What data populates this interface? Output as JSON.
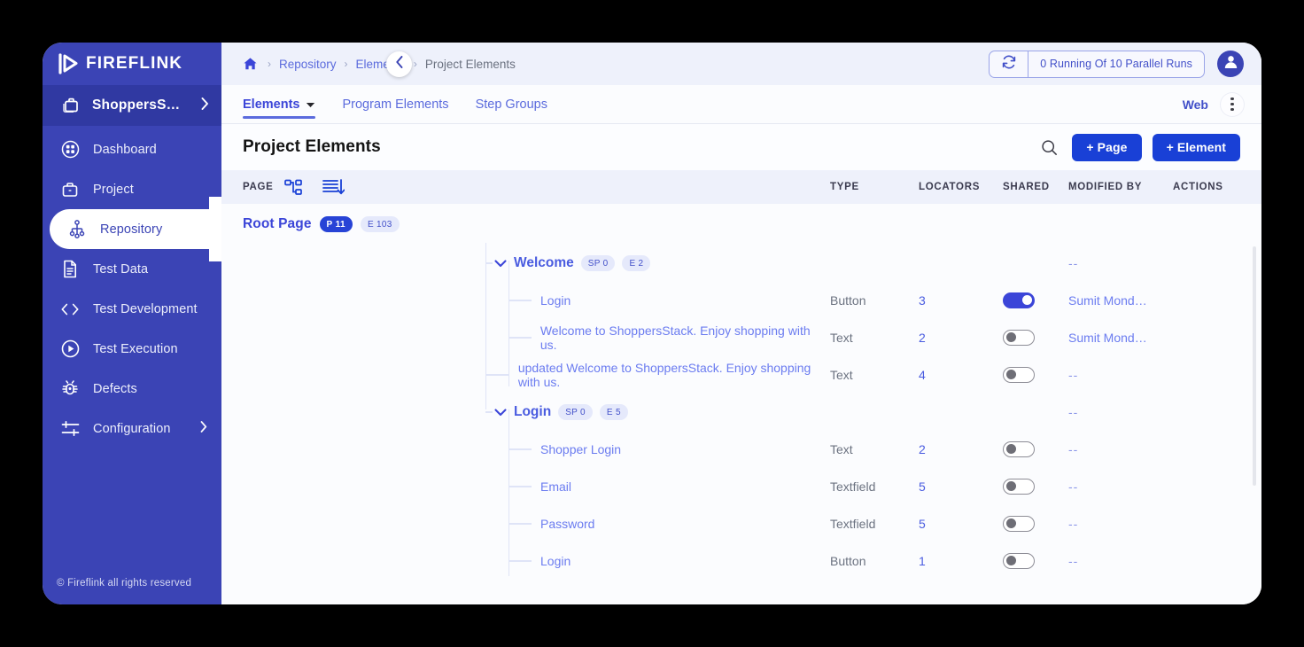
{
  "brand": {
    "name": "FIREFLINK"
  },
  "sidebar": {
    "project": {
      "label": "ShoppersS…",
      "chevron": "›"
    },
    "items": [
      {
        "label": "Dashboard",
        "icon": "dashboard-grid-icon",
        "active": false,
        "chevron": ""
      },
      {
        "label": "Project",
        "icon": "briefcase-icon",
        "active": false,
        "chevron": ""
      },
      {
        "label": "Repository",
        "icon": "repository-node-icon",
        "active": true,
        "chevron": ""
      },
      {
        "label": "Test Data",
        "icon": "document-icon",
        "active": false,
        "chevron": ""
      },
      {
        "label": "Test Development",
        "icon": "code-brackets-icon",
        "active": false,
        "chevron": ""
      },
      {
        "label": "Test Execution",
        "icon": "play-circle-icon",
        "active": false,
        "chevron": ""
      },
      {
        "label": "Defects",
        "icon": "bug-icon",
        "active": false,
        "chevron": ""
      },
      {
        "label": "Configuration",
        "icon": "sliders-icon",
        "active": false,
        "chevron": "›"
      }
    ],
    "footer": "© Fireflink all rights reserved"
  },
  "topbar": {
    "home_icon": "home-icon",
    "breadcrumbs": [
      {
        "label": "Repository",
        "current": false
      },
      {
        "label": "Elements",
        "current": false
      },
      {
        "label": "Project Elements",
        "current": true
      }
    ],
    "separator": "›",
    "refresh_icon": "refresh-icon",
    "runs_label": "0 Running Of 10 Parallel Runs",
    "avatar_icon": "user-avatar-icon",
    "collapse_icon": "chevron-left-icon"
  },
  "tabs": {
    "items": [
      {
        "label": "Elements",
        "active": true,
        "caret": true
      },
      {
        "label": "Program Elements",
        "active": false,
        "caret": false
      },
      {
        "label": "Step Groups",
        "active": false,
        "caret": false
      }
    ],
    "platform": "Web",
    "menu_icon": "kebab-menu-icon"
  },
  "title": {
    "heading": "Project Elements",
    "search_icon": "search-icon",
    "add_page": "+ Page",
    "add_element": "+ Element"
  },
  "table": {
    "headers": {
      "page": "PAGE",
      "hierarchy_icon": "hierarchy-tree-icon",
      "sort_icon": "sort-descending-icon",
      "type": "TYPE",
      "locators": "LOCATORS",
      "shared": "SHARED",
      "modified_by": "MODIFIED BY",
      "actions": "ACTIONS"
    },
    "rows": [
      {
        "kind": "page",
        "level": 0,
        "name": "Root Page",
        "badges": [
          {
            "text": "P 11",
            "style": "dark"
          },
          {
            "text": "E 103",
            "style": "light"
          }
        ],
        "type": "",
        "locators": "",
        "shared": null,
        "modified_by": ""
      },
      {
        "kind": "group",
        "level": 1,
        "name": "Welcome",
        "expanded": true,
        "badges": [
          {
            "text": "SP 0",
            "style": "light"
          },
          {
            "text": "E 2",
            "style": "light"
          }
        ],
        "type": "",
        "locators": "",
        "shared": null,
        "modified_by": "--"
      },
      {
        "kind": "element",
        "level": 2,
        "name": "Login",
        "badges": [],
        "type": "Button",
        "locators": "3",
        "shared": true,
        "modified_by": "Sumit Mond…"
      },
      {
        "kind": "element",
        "level": 2,
        "name": "Welcome to ShoppersStack. Enjoy shopping with us.",
        "badges": [],
        "type": "Text",
        "locators": "2",
        "shared": false,
        "modified_by": "Sumit Mond…"
      },
      {
        "kind": "element",
        "level": 2,
        "name": "updated Welcome to ShoppersStack. Enjoy shopping with us.",
        "badges": [],
        "type": "Text",
        "locators": "4",
        "shared": false,
        "modified_by": "--"
      },
      {
        "kind": "group",
        "level": 1,
        "name": "Login",
        "expanded": true,
        "badges": [
          {
            "text": "SP 0",
            "style": "light"
          },
          {
            "text": "E 5",
            "style": "light"
          }
        ],
        "type": "",
        "locators": "",
        "shared": null,
        "modified_by": "--"
      },
      {
        "kind": "element",
        "level": 2,
        "name": "Shopper Login",
        "badges": [],
        "type": "Text",
        "locators": "2",
        "shared": false,
        "modified_by": "--"
      },
      {
        "kind": "element",
        "level": 2,
        "name": "Email",
        "badges": [],
        "type": "Textfield",
        "locators": "5",
        "shared": false,
        "modified_by": "--"
      },
      {
        "kind": "element",
        "level": 2,
        "name": "Password",
        "badges": [],
        "type": "Textfield",
        "locators": "5",
        "shared": false,
        "modified_by": "--"
      },
      {
        "kind": "element",
        "level": 2,
        "name": "Login",
        "badges": [],
        "type": "Button",
        "locators": "1",
        "shared": false,
        "modified_by": "--"
      }
    ]
  },
  "colors": {
    "sidebar": "#3b44b5",
    "sidebar_active_row": "#3039a2",
    "primary": "#1940d6",
    "link": "#6b7cf0",
    "header_bg": "#eef1fb"
  }
}
